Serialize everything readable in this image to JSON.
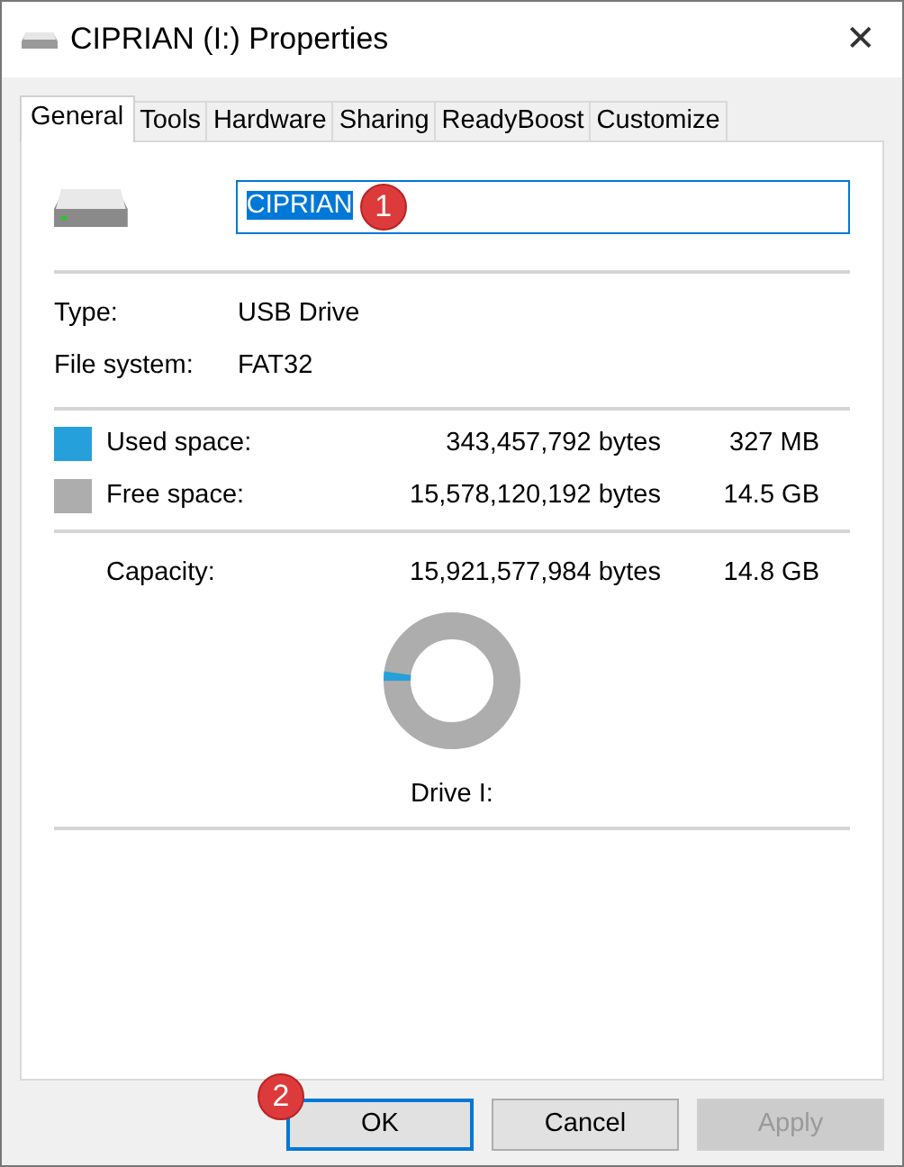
{
  "window": {
    "title": "CIPRIAN (I:) Properties",
    "close": "✕"
  },
  "tabs": [
    {
      "label": "General",
      "selected": true
    },
    {
      "label": "Tools",
      "selected": false
    },
    {
      "label": "Hardware",
      "selected": false
    },
    {
      "label": "Sharing",
      "selected": false
    },
    {
      "label": "ReadyBoost",
      "selected": false
    },
    {
      "label": "Customize",
      "selected": false
    }
  ],
  "name_field": {
    "value": "CIPRIAN",
    "callout": "1"
  },
  "info": [
    {
      "label": "Type:",
      "value": "USB Drive"
    },
    {
      "label": "File system:",
      "value": "FAT32"
    }
  ],
  "space": [
    {
      "label": "Used space:",
      "bytes": "343,457,792 bytes",
      "size": "327 MB",
      "color": "#26a0da"
    },
    {
      "label": "Free space:",
      "bytes": "15,578,120,192 bytes",
      "size": "14.5 GB",
      "color": "#adadad"
    }
  ],
  "capacity": {
    "label": "Capacity:",
    "bytes": "15,921,577,984 bytes",
    "size": "14.8 GB"
  },
  "usage_ring": {
    "level": 0.022
  },
  "drive_label": "Drive I:",
  "buttons": [
    {
      "label": "OK",
      "default": true,
      "disabled": false,
      "callout": "2"
    },
    {
      "label": "Cancel",
      "default": false,
      "disabled": false
    },
    {
      "label": "Apply",
      "default": false,
      "disabled": true
    }
  ]
}
